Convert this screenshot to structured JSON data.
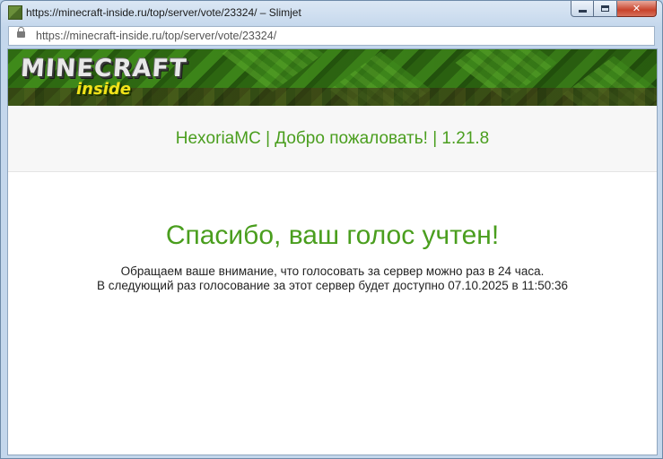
{
  "window": {
    "title": "https://minecraft-inside.ru/top/server/vote/23324/ – Slimjet",
    "controls": {
      "minimize": "",
      "maximize": "",
      "close": "✕"
    }
  },
  "address_bar": {
    "url": "https://minecraft-inside.ru/top/server/vote/23324/"
  },
  "banner": {
    "logo_main": "MINECRAFT",
    "logo_sub": "inside"
  },
  "server": {
    "title": "HexoriaMC | Добро пожаловать! | 1.21.8"
  },
  "vote_result": {
    "heading": "Спасибо, ваш голос учтен!",
    "line1": "Обращаем ваше внимание, что голосовать за сервер можно раз в 24 часа.",
    "line2": "В следующий раз голосование за этот сервер будет доступно 07.10.2025 в 11:50:36"
  },
  "colors": {
    "accent_green": "#4a9e1e",
    "close_red": "#c8432b"
  }
}
